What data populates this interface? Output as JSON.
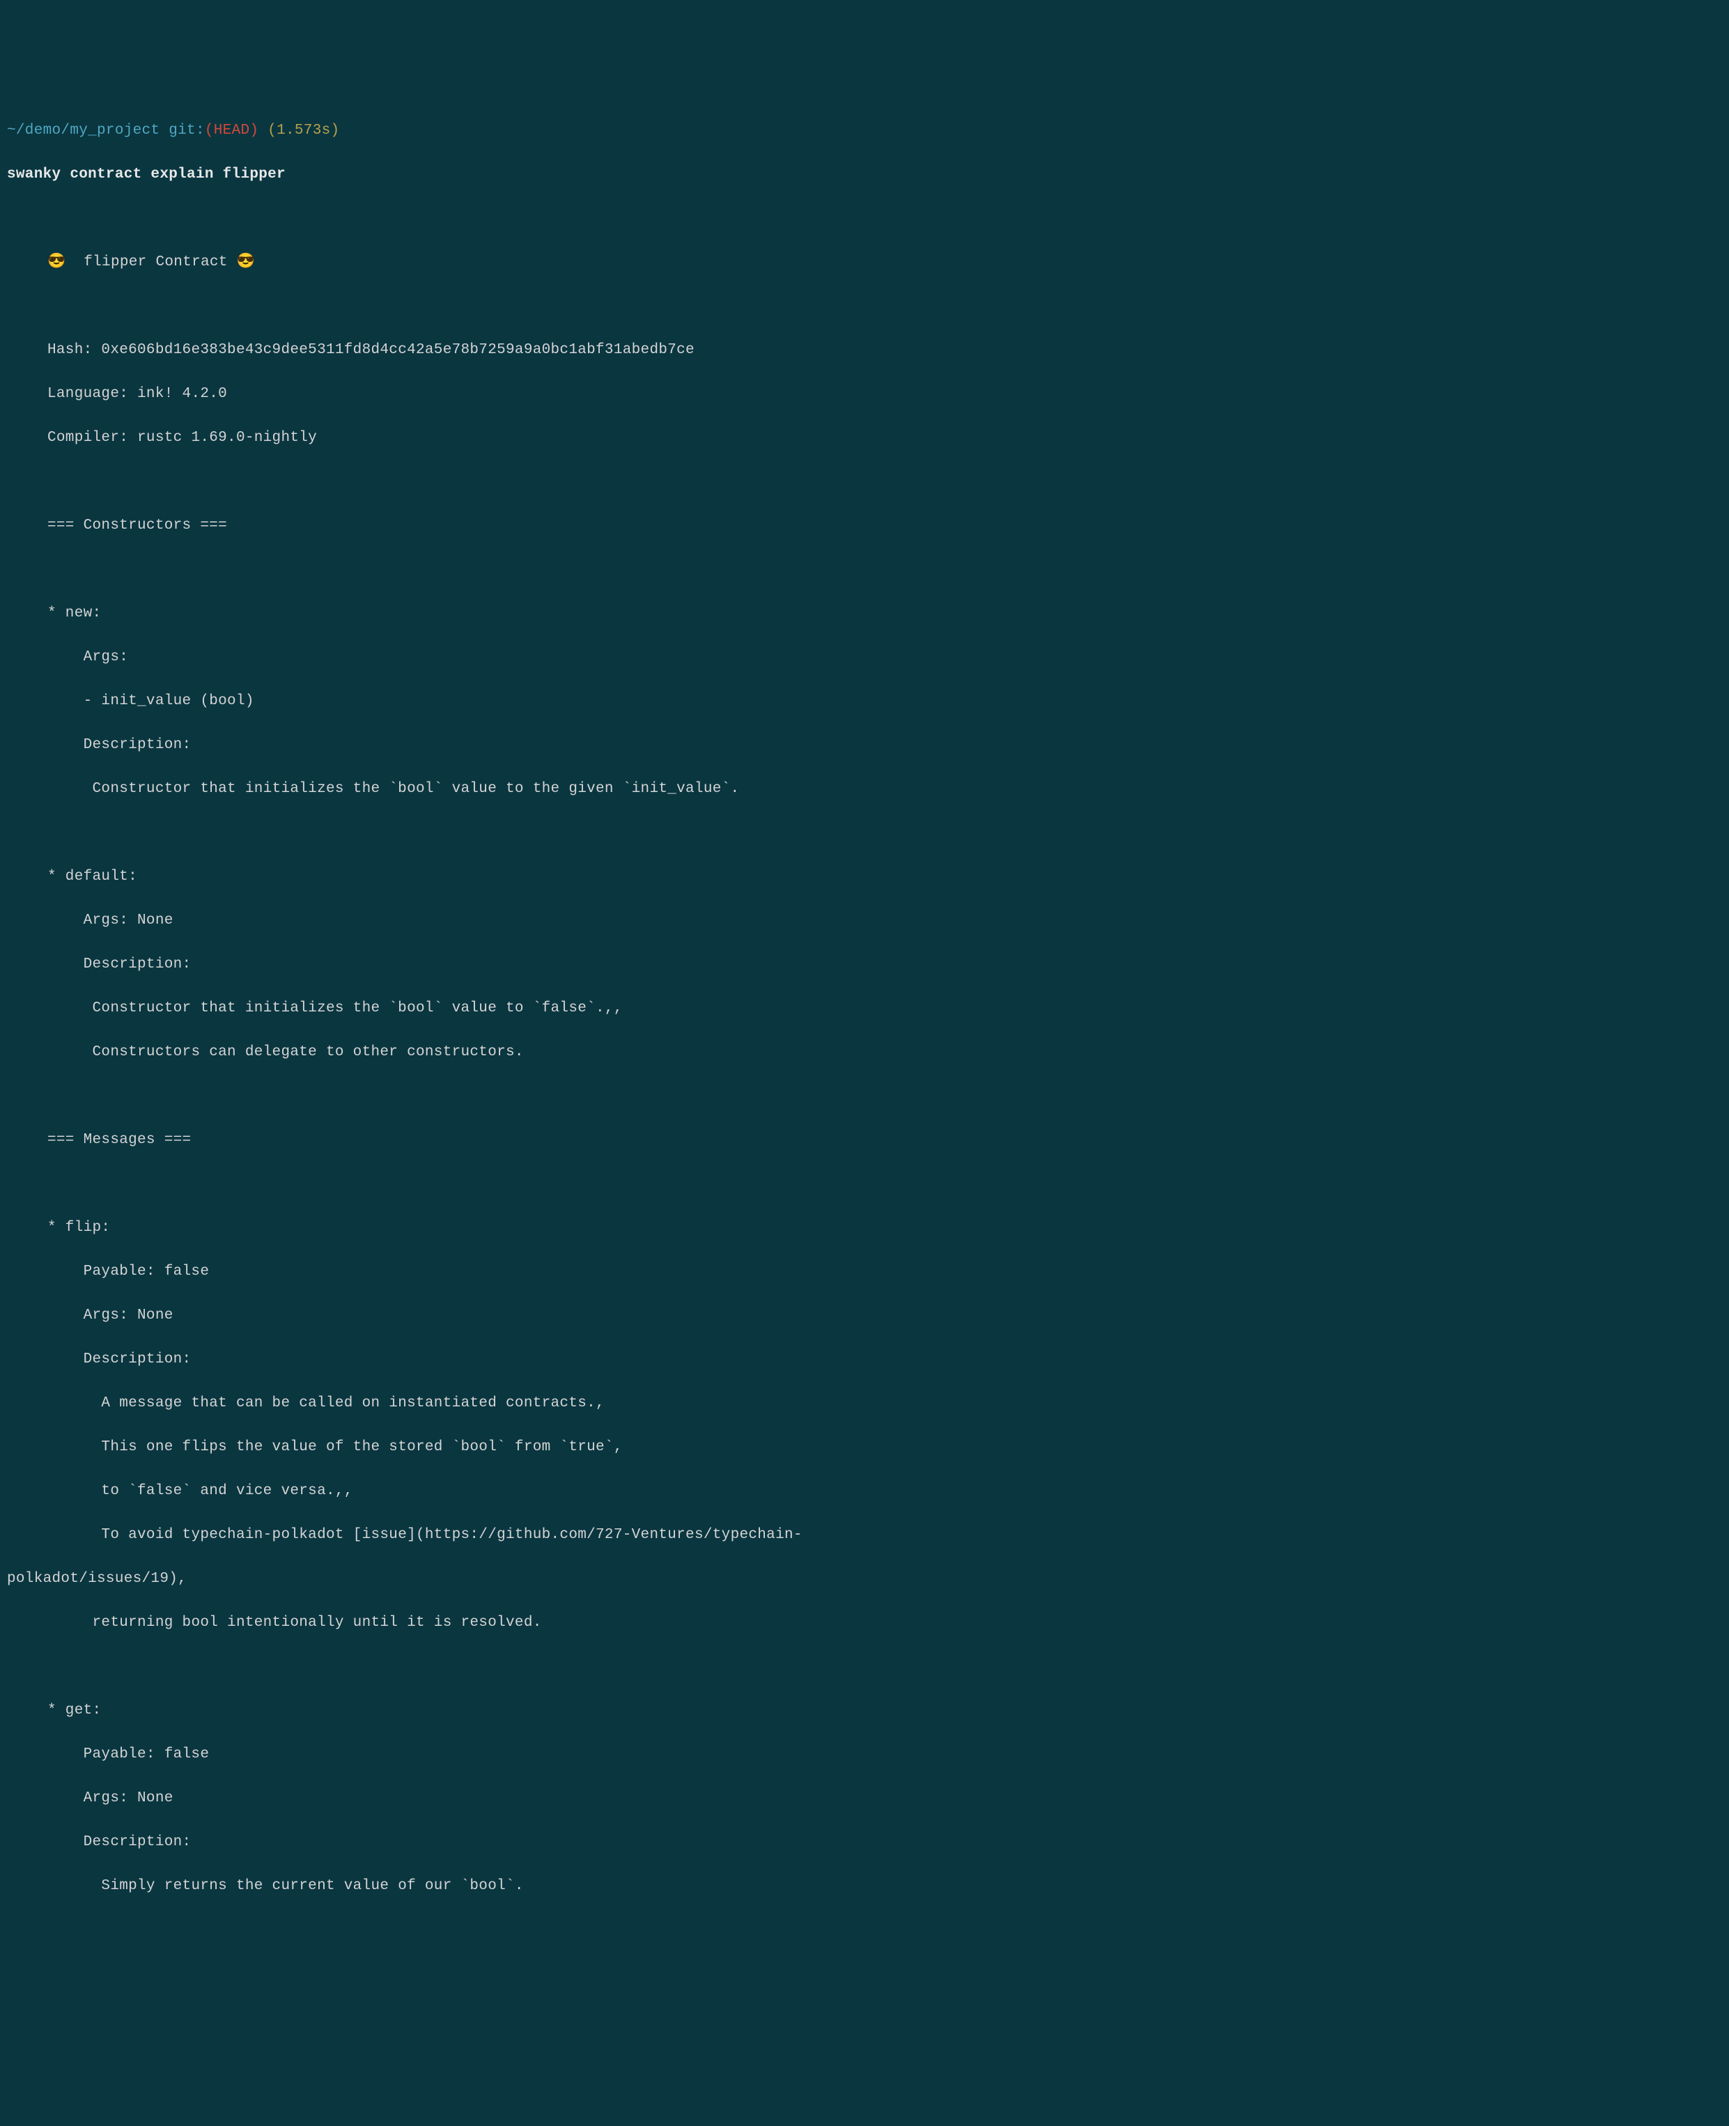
{
  "prompt": {
    "path": "~/demo/my_project",
    "git_label": " git:",
    "git_branch": "(HEAD)",
    "timing": " (1.573s)"
  },
  "command": "swanky contract explain flipper",
  "output": {
    "title": "😎  flipper Contract 😎",
    "hash_label": "Hash: ",
    "hash": "0xe606bd16e383be43c9dee5311fd8d4cc42a5e78b7259a9a0bc1abf31abedb7ce",
    "language_label": "Language: ",
    "language": "ink! 4.2.0",
    "compiler_label": "Compiler: ",
    "compiler": "rustc 1.69.0-nightly",
    "constructors_header": "=== Constructors ===",
    "constructors": {
      "new": {
        "name": "* new:",
        "args_label": "    Args:",
        "args_line1": "    - init_value (bool)",
        "desc_label": "    Description:",
        "desc_line1": "     Constructor that initializes the `bool` value to the given `init_value`."
      },
      "default": {
        "name": "* default:",
        "args_label": "    Args: None",
        "desc_label": "    Description:",
        "desc_line1": "     Constructor that initializes the `bool` value to `false`.,,",
        "desc_line2": "     Constructors can delegate to other constructors."
      }
    },
    "messages_header": "=== Messages ===",
    "messages": {
      "flip": {
        "name": "* flip:",
        "payable": "    Payable: false",
        "args_label": "    Args: None",
        "desc_label": "    Description:",
        "desc_line1": "      A message that can be called on instantiated contracts.,",
        "desc_line2": "      This one flips the value of the stored `bool` from `true`,",
        "desc_line3": "      to `false` and vice versa.,,",
        "desc_line4a": "      To avoid typechain-polkadot [issue](https://github.com/727-Ventures/typechain-",
        "desc_line4b": "polkadot/issues/19),",
        "desc_line5": "     returning bool intentionally until it is resolved."
      },
      "get": {
        "name": "* get:",
        "payable": "    Payable: false",
        "args_label": "    Args: None",
        "desc_label": "    Description:",
        "desc_line1": "      Simply returns the current value of our `bool`."
      }
    }
  }
}
